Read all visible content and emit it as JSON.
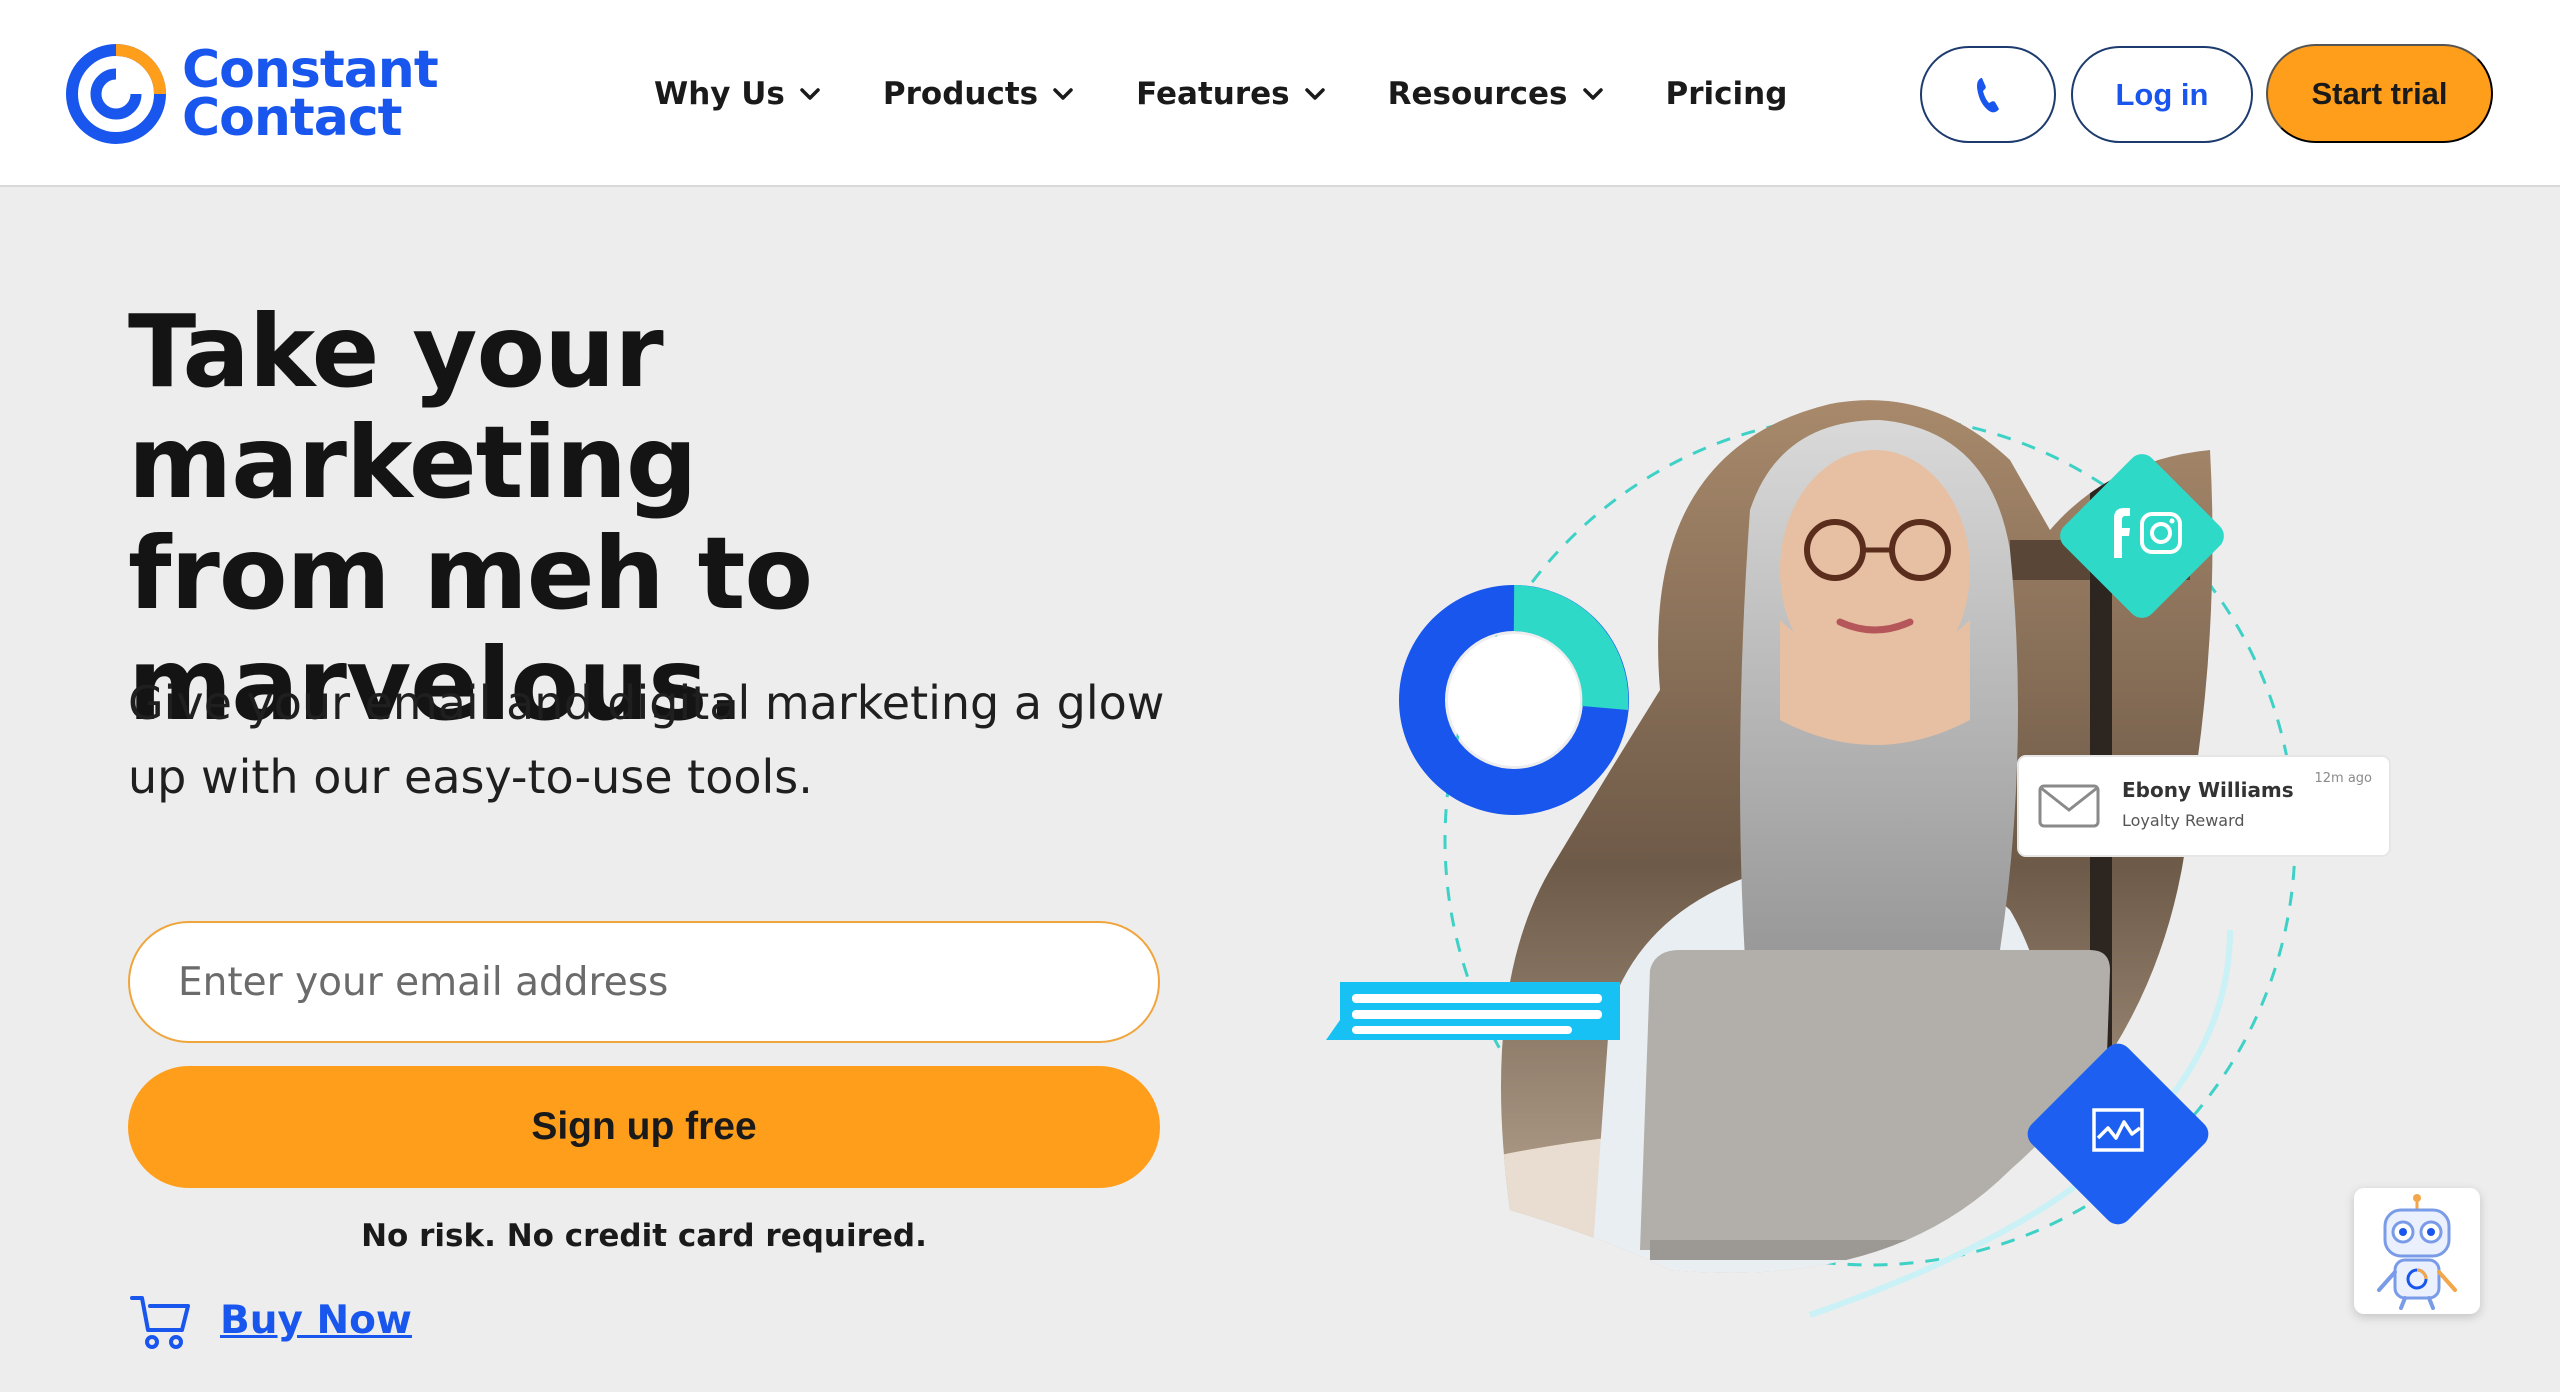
{
  "brand": {
    "name_line1": "Constant",
    "name_line2": "Contact",
    "color": "#1856ed"
  },
  "nav": {
    "items": [
      {
        "label": "Why Us",
        "has_dropdown": true
      },
      {
        "label": "Products",
        "has_dropdown": true
      },
      {
        "label": "Features",
        "has_dropdown": true
      },
      {
        "label": "Resources",
        "has_dropdown": true
      },
      {
        "label": "Pricing",
        "has_dropdown": false
      }
    ],
    "phone_icon": "phone-icon",
    "login_label": "Log in",
    "trial_label": "Start trial"
  },
  "hero": {
    "headline_line1": "Take your marketing",
    "headline_line2": "from meh to",
    "headline_line3": "marvelous.",
    "subhead_line1": "Give your email and digital marketing a glow",
    "subhead_line2": "up with our easy-to-use tools.",
    "email_placeholder": "Enter your email address",
    "signup_label": "Sign up free",
    "disclaimer": "No risk. No credit card required.",
    "buy_now_label": "Buy Now"
  },
  "art": {
    "notification_name": "Ebony Williams",
    "notification_subject": "Loyalty Reward",
    "notification_time": "12m ago",
    "social_icons": [
      "facebook-icon",
      "instagram-icon"
    ],
    "analytics_icon": "analytics-chart-icon"
  },
  "colors": {
    "accent_orange": "#ff9e1b",
    "brand_blue": "#1856ed",
    "teal": "#2fd9c8",
    "cyan": "#18c1f4",
    "background": "#ededed"
  }
}
